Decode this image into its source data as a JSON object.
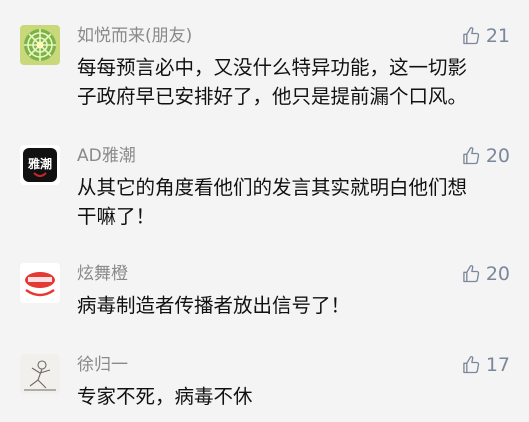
{
  "comments": [
    {
      "name": "如悦而来(朋友)",
      "likes": "21",
      "avatar": "green-flower-avatar",
      "lines": [
        "每每预言必中，又没什么特异功能，这一切影",
        "子政府早已安排好了，他只是提前漏个口风。"
      ]
    },
    {
      "name": "AD雅潮",
      "likes": "20",
      "avatar": "black-logo-avatar",
      "avatar_text": "雅潮",
      "lines": [
        "从其它的角度看他们的发言其实就明白他们想",
        "干嘛了！"
      ]
    },
    {
      "name": "炫舞橙",
      "likes": "20",
      "avatar": "red-logo-avatar",
      "lines": [
        "病毒制造者传播者放出信号了！"
      ]
    },
    {
      "name": "徐归一",
      "likes": "17",
      "avatar": "sketch-avatar",
      "lines": [
        "专家不死，病毒不休"
      ]
    }
  ],
  "colors": {
    "background": "#f4f4f4",
    "name_text": "#8a8a8a",
    "comment_text": "#111111",
    "like": "#7b879a"
  },
  "icons": {
    "like": "thumbs-up-icon"
  }
}
